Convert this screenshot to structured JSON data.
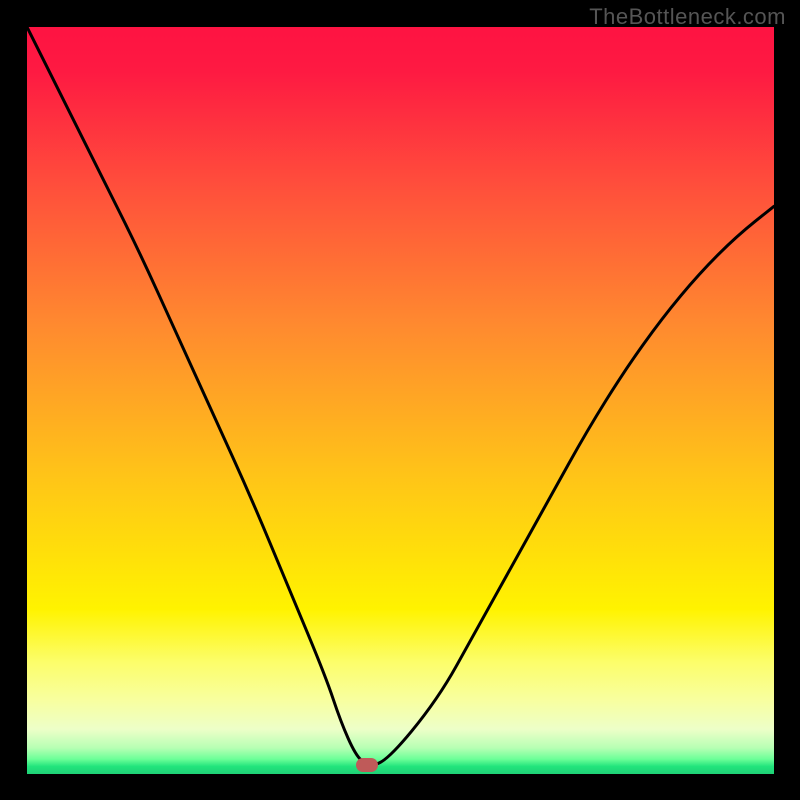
{
  "watermark": "TheBottleneck.com",
  "chart_data": {
    "type": "line",
    "title": "",
    "xlabel": "",
    "ylabel": "",
    "xlim": [
      0,
      100
    ],
    "ylim": [
      0,
      100
    ],
    "x": [
      0,
      5,
      10,
      15,
      20,
      25,
      30,
      35,
      40,
      42,
      44,
      45.5,
      48,
      55,
      60,
      65,
      70,
      75,
      80,
      85,
      90,
      95,
      100
    ],
    "values": [
      100,
      90,
      80,
      70,
      59,
      48,
      37,
      25,
      13,
      7,
      2.5,
      1.2,
      1.5,
      10,
      19,
      28,
      37,
      46,
      54,
      61,
      67,
      72,
      76
    ],
    "minimum_x": 45.5,
    "series": [
      {
        "name": "bottleneck-curve",
        "color": "#000000"
      }
    ],
    "background_gradient": {
      "top": "#fe1342",
      "mid": "#fff300",
      "bottom": "#1fd076"
    },
    "marker": {
      "x": 45.5,
      "y": 1.2,
      "color": "#bf5a59"
    }
  }
}
